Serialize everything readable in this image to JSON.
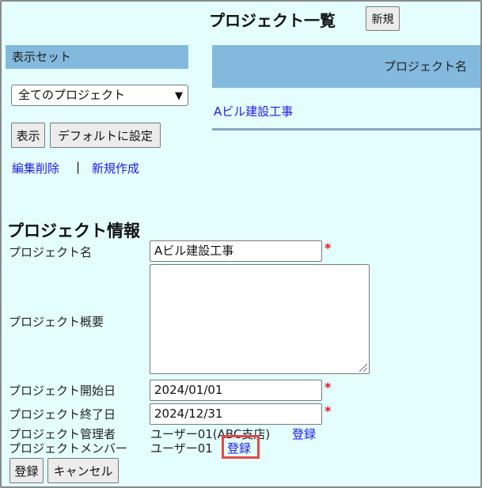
{
  "header": {
    "title": "プロジェクト一覧",
    "new_button": "新規"
  },
  "sidebar": {
    "display_set_label": "表示セット",
    "select_value": "全てのプロジェクト",
    "show_button": "表示",
    "default_button": "デフォルトに設定",
    "edit_delete_link": "編集削除",
    "separator": "|",
    "new_create_link": "新規作成"
  },
  "project_table": {
    "column_header": "プロジェクト名",
    "rows": [
      {
        "name": "Aビル建設工事"
      }
    ]
  },
  "project_info": {
    "section_title": "プロジェクト情報",
    "name_label": "プロジェクト名",
    "name_value": "Aビル建設工事",
    "summary_label": "プロジェクト概要",
    "summary_value": "",
    "start_label": "プロジェクト開始日",
    "start_value": "2024/01/01",
    "end_label": "プロジェクト終了日",
    "end_value": "2024/12/31",
    "manager_label": "プロジェクト管理者",
    "manager_value": "ユーザー01(ABC支店)",
    "manager_register_link": "登録",
    "member_label": "プロジェクトメンバー",
    "member_value": "ユーザー01",
    "member_register_link": "登録",
    "required_mark": "*"
  },
  "form_actions": {
    "register_button": "登録",
    "cancel_button": "キャンセル"
  },
  "colors": {
    "background": "#e4feff",
    "header_band": "#83b9dd",
    "link": "#1a1aee",
    "required": "#e8141c",
    "highlight": "#e84747"
  }
}
